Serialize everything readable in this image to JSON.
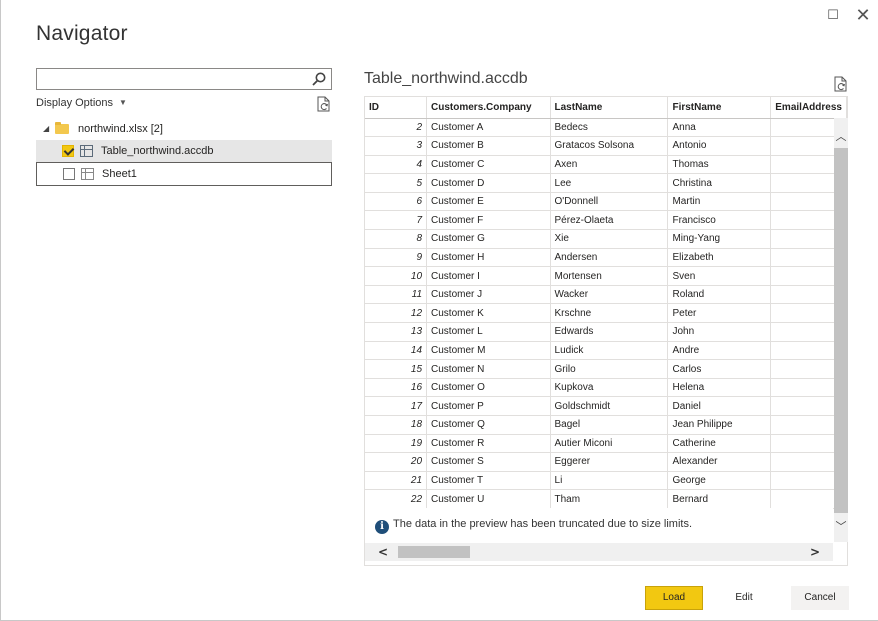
{
  "window": {
    "title": "Navigator",
    "maximize_glyph": "☐",
    "close_glyph": "✕"
  },
  "left_pane": {
    "search": {
      "value": "",
      "placeholder": ""
    },
    "display_options_label": "Display Options",
    "tree": {
      "root": {
        "label": "northwind.xlsx [2]",
        "icon": "folder-icon",
        "expanded": true
      },
      "items": [
        {
          "label": "Table_northwind.accdb",
          "checked": true,
          "selected": true,
          "icon": "table-icon"
        },
        {
          "label": "Sheet1",
          "checked": false,
          "selected": false,
          "icon": "sheet-icon"
        }
      ]
    }
  },
  "preview": {
    "title": "Table_northwind.accdb",
    "columns": [
      "ID",
      "Customers.Company",
      "LastName",
      "FirstName",
      "EmailAddress"
    ],
    "rows": [
      [
        "2",
        "Customer A",
        "Bedecs",
        "Anna",
        ""
      ],
      [
        "3",
        "Customer B",
        "Gratacos Solsona",
        "Antonio",
        ""
      ],
      [
        "4",
        "Customer C",
        "Axen",
        "Thomas",
        ""
      ],
      [
        "5",
        "Customer D",
        "Lee",
        "Christina",
        ""
      ],
      [
        "6",
        "Customer E",
        "O'Donnell",
        "Martin",
        ""
      ],
      [
        "7",
        "Customer F",
        "Pérez-Olaeta",
        "Francisco",
        ""
      ],
      [
        "8",
        "Customer G",
        "Xie",
        "Ming-Yang",
        ""
      ],
      [
        "9",
        "Customer H",
        "Andersen",
        "Elizabeth",
        ""
      ],
      [
        "10",
        "Customer I",
        "Mortensen",
        "Sven",
        ""
      ],
      [
        "11",
        "Customer J",
        "Wacker",
        "Roland",
        ""
      ],
      [
        "12",
        "Customer K",
        "Krschne",
        "Peter",
        ""
      ],
      [
        "13",
        "Customer L",
        "Edwards",
        "John",
        ""
      ],
      [
        "14",
        "Customer M",
        "Ludick",
        "Andre",
        ""
      ],
      [
        "15",
        "Customer N",
        "Grilo",
        "Carlos",
        ""
      ],
      [
        "16",
        "Customer O",
        "Kupkova",
        "Helena",
        ""
      ],
      [
        "17",
        "Customer P",
        "Goldschmidt",
        "Daniel",
        ""
      ],
      [
        "18",
        "Customer Q",
        "Bagel",
        "Jean Philippe",
        ""
      ],
      [
        "19",
        "Customer R",
        "Autier Miconi",
        "Catherine",
        ""
      ],
      [
        "20",
        "Customer S",
        "Eggerer",
        "Alexander",
        ""
      ],
      [
        "21",
        "Customer T",
        "Li",
        "George",
        ""
      ],
      [
        "22",
        "Customer U",
        "Tham",
        "Bernard",
        ""
      ]
    ],
    "truncation_note": "The data in the preview has been truncated due to size limits."
  },
  "buttons": {
    "load": "Load",
    "edit": "Edit",
    "cancel": "Cancel"
  },
  "colors": {
    "accent": "#f2c811",
    "info": "#1f4e79"
  }
}
